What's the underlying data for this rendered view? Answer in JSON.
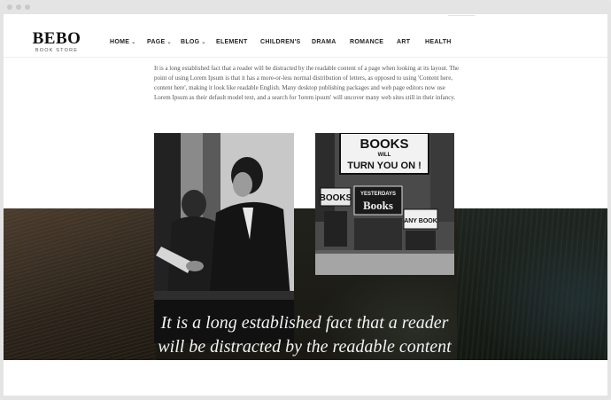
{
  "header": {
    "logo_title": "BEBO",
    "logo_subtitle": "BOOK STORE",
    "nav": [
      {
        "label": "HOME",
        "has_dropdown": true
      },
      {
        "label": "PAGE",
        "has_dropdown": true
      },
      {
        "label": "BLOG",
        "has_dropdown": true
      },
      {
        "label": "ELEMENT",
        "has_dropdown": false
      },
      {
        "label": "CHILDREN'S",
        "has_dropdown": false
      },
      {
        "label": "DRAMA",
        "has_dropdown": false
      },
      {
        "label": "ROMANCE",
        "has_dropdown": false
      },
      {
        "label": "ART",
        "has_dropdown": false
      },
      {
        "label": "HEALTH",
        "has_dropdown": false
      }
    ]
  },
  "content": {
    "paragraph": "It is a long established fact that a reader will be distracted by the readable content of a page when looking at its layout. The point of using Lorem Ipsum is that it has a more-or-less normal distribution of letters, as opposed to using 'Content here, content here', making it look like readable English. Many desktop publishing packages and web page editors now use Lorem Ipsum as their default model text, and a search for 'lorem ipsum' will uncover many web sites still in their infancy.",
    "photo_right_sign": {
      "line1": "BOOKS",
      "line2": "WILL",
      "line3": "TURN YOU ON !",
      "shop1": "BOOKS",
      "shop2": "YESTERDAYS",
      "shop3": "Books",
      "shop4": "ANY BOOK"
    },
    "quote_line1": "It is a long established fact that a reader",
    "quote_line2": "will be distracted by the readable content"
  },
  "colors": {
    "background": "#ffffff",
    "text": "#222222",
    "band": "#1f1e19"
  }
}
